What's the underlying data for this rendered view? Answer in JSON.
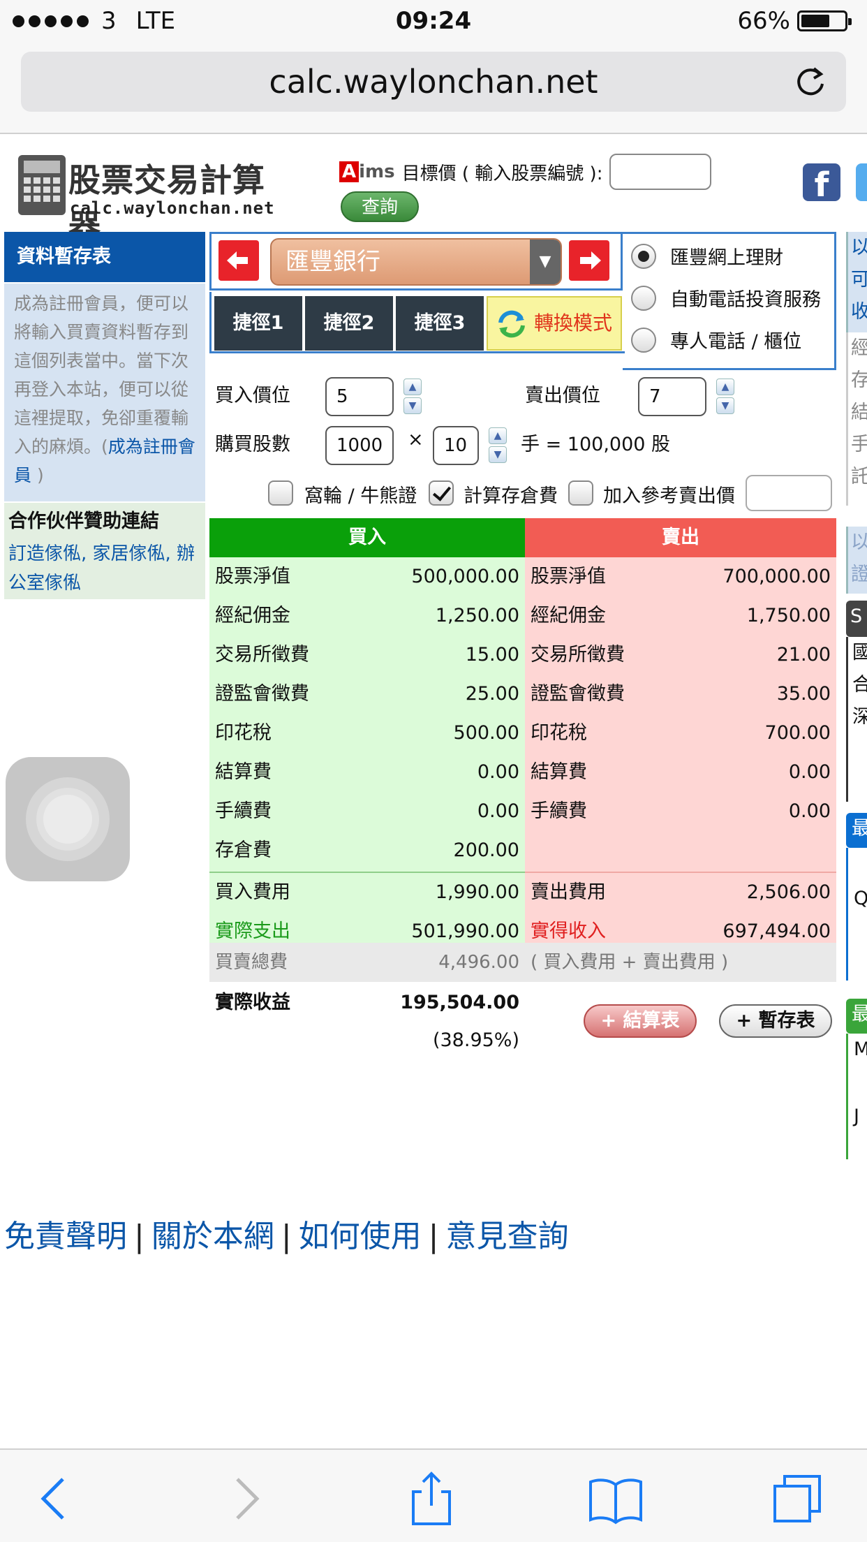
{
  "status_bar": {
    "carrier": "3",
    "network": "LTE",
    "time": "09:24",
    "battery_pct": "66%",
    "battery_level": 0.66
  },
  "browser": {
    "url": "calc.waylonchan.net",
    "reload_icon": "reload-icon"
  },
  "header": {
    "logo_title": "股票交易計算器",
    "logo_subtitle": "calc.waylonchan.net",
    "aims_logo_a": "A",
    "aims_logo_b": "ims",
    "target_label": "目標價 ( 輸入股票編號 ):",
    "target_input": "",
    "query_button": "查詢",
    "facebook": "f"
  },
  "sidebar": {
    "title": "資料暫存表",
    "description": "成為註冊會員，便可以將輸入買賣資料暫存到這個列表當中。當下次再登入本站，便可以從這裡提取，免卻重覆輸入的麻煩。(",
    "register_link": "成為註冊會員",
    "close_paren": " )",
    "partner_title": "合作伙伴贊助連結",
    "partner_link": "訂造傢俬, 家居傢俬, 辦公室傢俬"
  },
  "calculator": {
    "stock_name": "匯豐銀行",
    "broker_options": [
      {
        "label": "匯豐網上理財",
        "selected": true
      },
      {
        "label": "自動電話投資服務",
        "selected": false
      },
      {
        "label": "專人電話 / 櫃位",
        "selected": false
      }
    ],
    "shortcuts": [
      "捷徑1",
      "捷徑2",
      "捷徑3"
    ],
    "mode_button": "轉換模式",
    "buy_price_label": "買入價位",
    "buy_price": "5",
    "sell_price_label": "賣出價位",
    "sell_price": "7",
    "quantity_label": "購買股數",
    "lot_size": "1000",
    "times": "×",
    "lots": "10",
    "shares_text": "手 = 100,000 股",
    "options": [
      {
        "label": "窩輪 / 牛熊證",
        "checked": false
      },
      {
        "label": "計算存倉費",
        "checked": true
      },
      {
        "label": "加入參考賣出價",
        "checked": false
      }
    ],
    "ref_sell_price": ""
  },
  "table": {
    "buy_header": "買入",
    "sell_header": "賣出",
    "buy_color": "#0aa00a",
    "sell_color": "#f25c54",
    "buy_rows": [
      {
        "label": "股票淨值",
        "value": "500,000.00"
      },
      {
        "label": "經紀佣金",
        "value": "1,250.00"
      },
      {
        "label": "交易所徵費",
        "value": "15.00"
      },
      {
        "label": "證監會徵費",
        "value": "25.00"
      },
      {
        "label": "印花稅",
        "value": "500.00"
      },
      {
        "label": "結算費",
        "value": "0.00"
      },
      {
        "label": "手續費",
        "value": "0.00"
      },
      {
        "label": "存倉費",
        "value": "200.00"
      }
    ],
    "sell_rows": [
      {
        "label": "股票淨值",
        "value": "700,000.00"
      },
      {
        "label": "經紀佣金",
        "value": "1,750.00"
      },
      {
        "label": "交易所徵費",
        "value": "21.00"
      },
      {
        "label": "證監會徵費",
        "value": "35.00"
      },
      {
        "label": "印花稅",
        "value": "700.00"
      },
      {
        "label": "結算費",
        "value": "0.00"
      },
      {
        "label": "手續費",
        "value": "0.00"
      }
    ],
    "buy_cost_label": "買入費用",
    "buy_cost": "1,990.00",
    "buy_actual_label": "實際支出",
    "buy_actual": "501,990.00",
    "sell_cost_label": "賣出費用",
    "sell_cost": "2,506.00",
    "sell_actual_label": "實得收入",
    "sell_actual": "697,494.00",
    "total_fee_label": "買賣總費",
    "total_fee": "4,496.00",
    "total_fee_note": "( 買入費用 + 賣出費用 )",
    "profit_label": "實際收益",
    "profit": "195,504.00",
    "profit_pct": "(38.95%)",
    "settle_button": "+ 結算表",
    "save_button": "+ 暫存表"
  },
  "right_clip": {
    "top": [
      "以",
      "可",
      "收"
    ],
    "mid": [
      "經",
      "存",
      "結",
      "手",
      "託"
    ],
    "blue2": [
      "以",
      "證"
    ],
    "s_head": "S",
    "gray": [
      "國",
      "合",
      "深"
    ],
    "blue_head": "最",
    "blue_body": [
      "Q"
    ],
    "green_head": "最",
    "green_body": [
      "M",
      "J"
    ]
  },
  "footer": {
    "links": [
      "免責聲明",
      "關於本網",
      "如何使用",
      "意見查詢"
    ],
    "separator": "|"
  },
  "toolbar_icons": [
    "back-icon",
    "forward-icon",
    "share-icon",
    "bookmarks-icon",
    "tabs-icon"
  ]
}
